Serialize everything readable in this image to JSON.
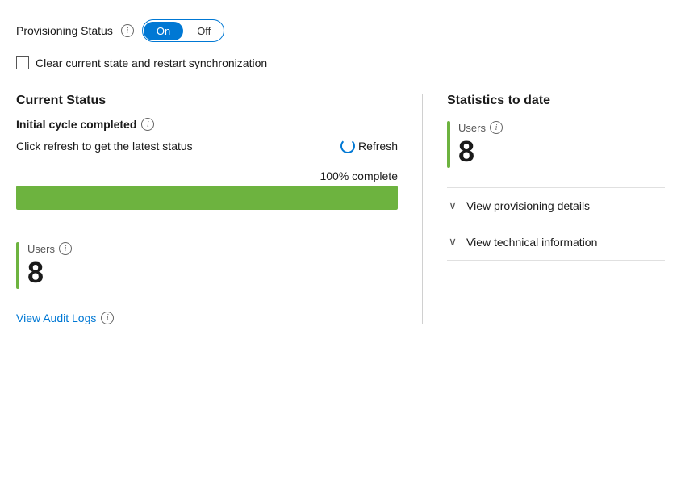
{
  "provisioning": {
    "status_label": "Provisioning Status",
    "toggle_on": "On",
    "toggle_off": "Off",
    "checkbox_label": "Clear current state and restart synchronization"
  },
  "current_status": {
    "section_title": "Current Status",
    "status_text": "Initial cycle completed",
    "refresh_hint": "Click refresh to get the latest status",
    "refresh_label": "Refresh",
    "progress_label": "100% complete",
    "progress_pct": 100
  },
  "bottom": {
    "users_label": "Users",
    "users_count": "8",
    "audit_link": "View Audit Logs"
  },
  "statistics": {
    "title": "Statistics to date",
    "users_label": "Users",
    "users_count": "8"
  },
  "expand_items": [
    {
      "label": "View provisioning details"
    },
    {
      "label": "View technical information"
    }
  ],
  "icons": {
    "info": "i",
    "chevron_down": "∨",
    "refresh_char": "↻"
  },
  "colors": {
    "accent_blue": "#0078d4",
    "progress_green": "#6db33f",
    "bar_green": "#6db33f"
  }
}
